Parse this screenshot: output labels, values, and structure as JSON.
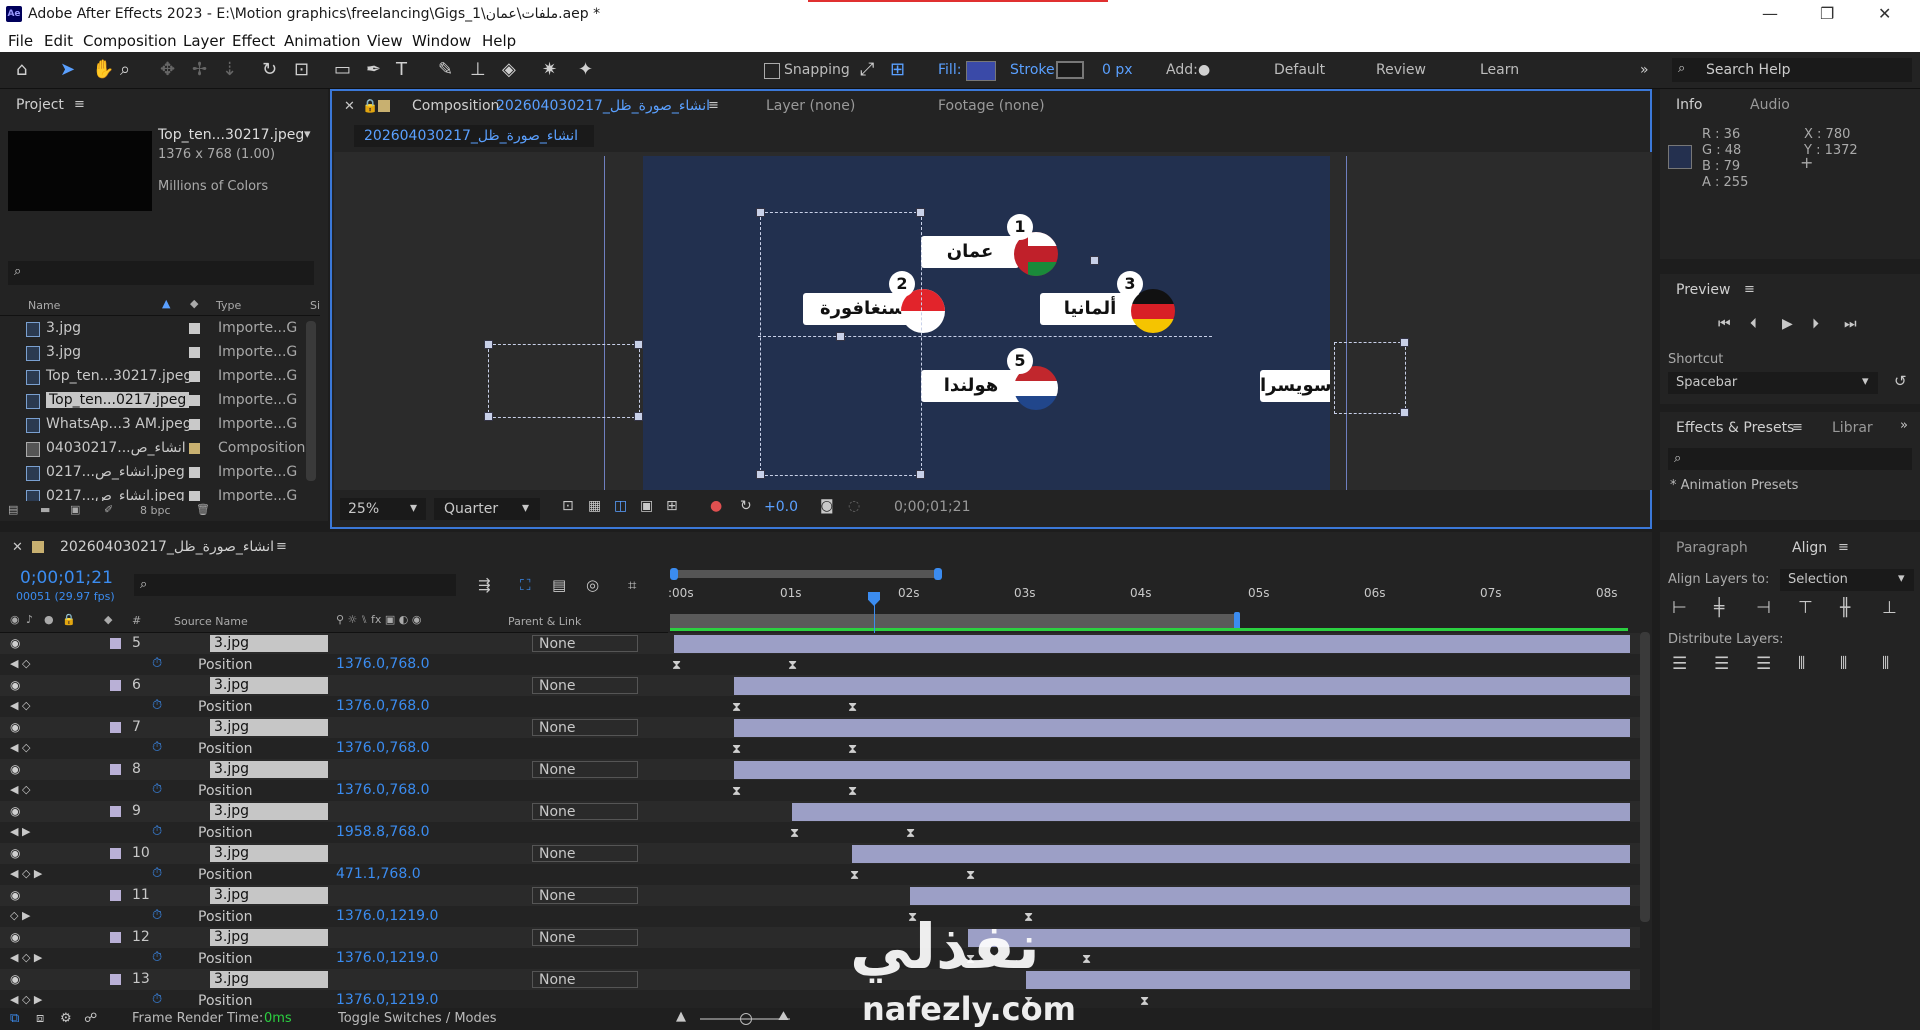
{
  "window": {
    "title": "Adobe After Effects 2023 - E:\\Motion graphics\\freelancing\\Gigs_1\\ملفات\\عمان.aep *",
    "app_icon": "Ae",
    "controls": [
      "—",
      "❐",
      "✕"
    ]
  },
  "menu": [
    "File",
    "Edit",
    "Composition",
    "Layer",
    "Effect",
    "Animation",
    "View",
    "Window",
    "Help"
  ],
  "toolbar": {
    "snapping": "Snapping",
    "fill": "Fill:",
    "stroke": "Stroke:",
    "stroke_px": "0 px",
    "add": "Add:",
    "workspaces": [
      "Default",
      "Review",
      "Learn"
    ],
    "search_help": "Search Help"
  },
  "project": {
    "title": "Project",
    "item_name": "Top_ten...30217.jpeg",
    "item_dims": "1376 x 768 (1.00)",
    "item_colors": "Millions of Colors",
    "col_name": "Name",
    "col_type": "Type",
    "col_size": "Si",
    "bpc": "8 bpc",
    "items": [
      {
        "name": "3.jpg",
        "type": "Importe...G"
      },
      {
        "name": "3.jpg",
        "type": "Importe...G"
      },
      {
        "name": "Top_ten...30217.jpeg",
        "type": "Importe...G"
      },
      {
        "name": "Top_ten...0217.jpeg",
        "type": "Importe...G"
      },
      {
        "name": "WhatsAp...3 AM.jpeg",
        "type": "Importe...G"
      },
      {
        "name": "04030217...انشاء_ص",
        "type": "Composition"
      },
      {
        "name": "0217...انشاء_ص.jpeg",
        "type": "Importe...G"
      },
      {
        "name": "0217...انشاء_ص.jpeg",
        "type": "Importe...G"
      }
    ]
  },
  "composition": {
    "tab_label": "Composition",
    "tab_name": "202604030217_انشاء_صورة_ظل",
    "layer_tab": "Layer  (none)",
    "footage_tab": "Footage  (none)",
    "sub_tab": "202604030217_انشاء_صورة_ظل",
    "zoom": "25%",
    "resolution": "Quarter",
    "exposure": "+0.0",
    "timecode": "0;00;01;21",
    "labels": [
      {
        "text": "عمان",
        "badge": "1"
      },
      {
        "text": "سنغافورة",
        "badge": "2"
      },
      {
        "text": "ألمانيا",
        "badge": "3"
      },
      {
        "text": "هولندا",
        "badge": "5"
      },
      {
        "text": "سويسرا"
      }
    ]
  },
  "info": {
    "title": "Info",
    "audio": "Audio",
    "r": "R : 36",
    "g": "G : 48",
    "b": "B : 79",
    "a": "A : 255",
    "x": "X : 780",
    "y": "Y : 1372",
    "swatch": "#24304f"
  },
  "preview": {
    "title": "Preview",
    "shortcut_label": "Shortcut",
    "shortcut_value": "Spacebar"
  },
  "effects": {
    "title": "Effects & Presets",
    "library": "Librar",
    "presets": "* Animation Presets"
  },
  "align": {
    "paragraph": "Paragraph",
    "title": "Align",
    "align_to_label": "Align Layers to:",
    "align_to_value": "Selection",
    "distribute": "Distribute Layers:"
  },
  "timeline": {
    "comp_name": "202604030217_انشاء_صورة_ظل",
    "timecode": "0;00;01;21",
    "frames": "00051 (29.97 fps)",
    "col_source": "Source Name",
    "col_parent": "Parent & Link",
    "ruler": [
      ":00s",
      "01s",
      "02s",
      "03s",
      "04s",
      "05s",
      "06s",
      "07s",
      "08s"
    ],
    "layers": [
      {
        "num": "5",
        "name": "3.jpg",
        "parent": "None",
        "prop": "Position",
        "value": "1376.0,768.0"
      },
      {
        "num": "6",
        "name": "3.jpg",
        "parent": "None",
        "prop": "Position",
        "value": "1376.0,768.0"
      },
      {
        "num": "7",
        "name": "3.jpg",
        "parent": "None",
        "prop": "Position",
        "value": "1376.0,768.0"
      },
      {
        "num": "8",
        "name": "3.jpg",
        "parent": "None",
        "prop": "Position",
        "value": "1376.0,768.0"
      },
      {
        "num": "9",
        "name": "3.jpg",
        "parent": "None",
        "prop": "Position",
        "value": "1958.8,768.0"
      },
      {
        "num": "10",
        "name": "3.jpg",
        "parent": "None",
        "prop": "Position",
        "value": "471.1,768.0"
      },
      {
        "num": "11",
        "name": "3.jpg",
        "parent": "None",
        "prop": "Position",
        "value": "1376.0,1219.0"
      },
      {
        "num": "12",
        "name": "3.jpg",
        "parent": "None",
        "prop": "Position",
        "value": "1376.0,1219.0"
      },
      {
        "num": "13",
        "name": "3.jpg",
        "parent": "None",
        "prop": "Position",
        "value": "1376.0,1219.0"
      }
    ],
    "frame_render": "Frame Render Time:",
    "frame_render_value": "0ms",
    "toggle": "Toggle Switches / Modes"
  },
  "watermark": {
    "arabic": "نفذلي",
    "latin": "nafezly.com"
  }
}
